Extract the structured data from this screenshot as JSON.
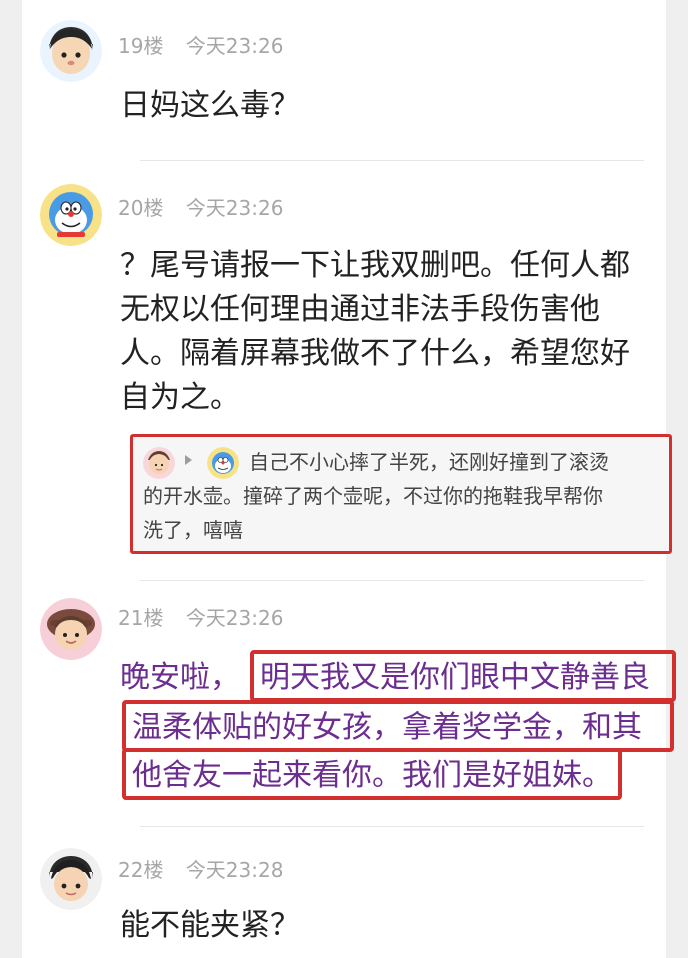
{
  "posts": [
    {
      "floor": "19楼",
      "time": "今天23:26",
      "avatar_icon": "cartoon-boy-avatar-icon",
      "content_lines": [
        "日妈这么毒？"
      ]
    },
    {
      "floor": "20楼",
      "time": "今天23:26",
      "avatar_icon": "doraemon-avatar-icon",
      "content_lines": [
        "？尾号请报一下让我双删吧。任何人都",
        "无权以任何理由通过非法手段伤害他",
        "人。隔着屏幕我做不了什么，希望您好",
        "自为之。"
      ],
      "reply": {
        "from_avatar_icon": "cartoon-girl-avatar-icon",
        "to_avatar_icon": "doraemon-avatar-icon",
        "arrow_icon": "reply-arrow-icon",
        "lines": [
          "自己不小心摔了半死，还刚好撞到了滚烫",
          "的开水壶。撞碎了两个壶呢，不过你的拖鞋我早帮你",
          "洗了，嘻嘻"
        ]
      }
    },
    {
      "floor": "21楼",
      "time": "今天23:26",
      "avatar_icon": "cartoon-girl-hat-avatar-icon",
      "content_prefix": "晚安啦，",
      "content_lines": [
        "明天我又是你们眼中文静善良",
        "温柔体贴的好女孩，拿着奖学金，和其",
        "他舍友一起来看你。我们是好姐妹。"
      ]
    },
    {
      "floor": "22楼",
      "time": "今天23:28",
      "avatar_icon": "cartoon-dark-hair-avatar-icon",
      "content_lines": [
        "能不能夹紧？"
      ]
    }
  ],
  "colors": {
    "highlight_border": "#d22f2f",
    "purple_text": "#6b2d8f",
    "meta_text": "#a6a6a6",
    "body_text": "#222222"
  }
}
